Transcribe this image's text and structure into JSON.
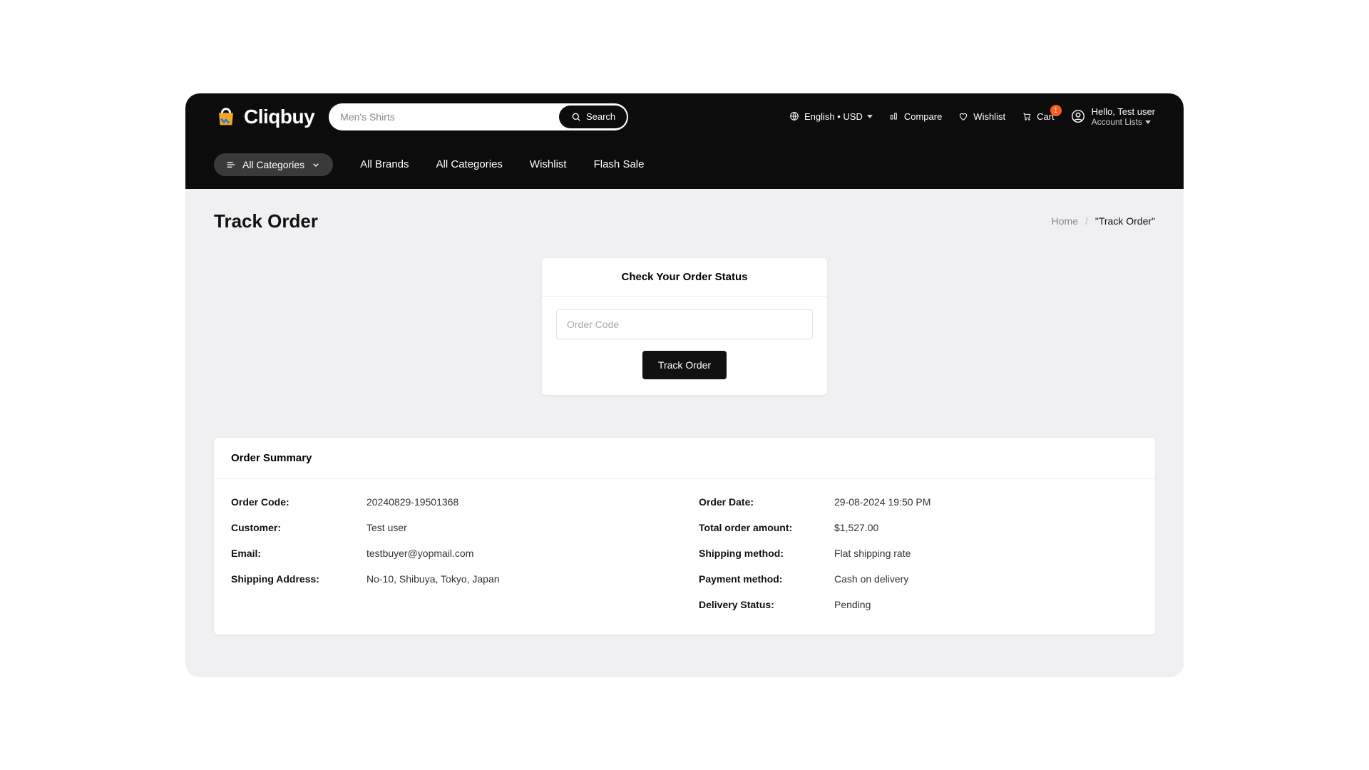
{
  "brand": "Cliqbuy",
  "search": {
    "placeholder": "Men's Shirts",
    "button": "Search"
  },
  "top": {
    "language": "English • USD",
    "compare": "Compare",
    "wishlist": "Wishlist",
    "cart": "Cart",
    "cart_count": "1",
    "hello": "Hello, Test user",
    "account_sub": "Account Lists"
  },
  "nav": {
    "all_cat_pill": "All Categories",
    "links": [
      "All Brands",
      "All Categories",
      "Wishlist",
      "Flash Sale"
    ]
  },
  "page": {
    "title": "Track Order",
    "breadcrumb_home": "Home",
    "breadcrumb_current": "\"Track Order\""
  },
  "status": {
    "heading": "Check Your Order Status",
    "placeholder": "Order Code",
    "button": "Track Order"
  },
  "summary": {
    "heading": "Order Summary",
    "left": [
      {
        "label": "Order Code:",
        "value": "20240829-19501368"
      },
      {
        "label": "Customer:",
        "value": "Test user"
      },
      {
        "label": "Email:",
        "value": "testbuyer@yopmail.com"
      },
      {
        "label": "Shipping Address:",
        "value": "No-10, Shibuya, Tokyo, Japan"
      }
    ],
    "right": [
      {
        "label": "Order Date:",
        "value": "29-08-2024 19:50 PM"
      },
      {
        "label": "Total order amount:",
        "value": "$1,527.00"
      },
      {
        "label": "Shipping method:",
        "value": "Flat shipping rate"
      },
      {
        "label": "Payment method:",
        "value": "Cash on delivery"
      },
      {
        "label": "Delivery Status:",
        "value": "Pending"
      }
    ]
  }
}
